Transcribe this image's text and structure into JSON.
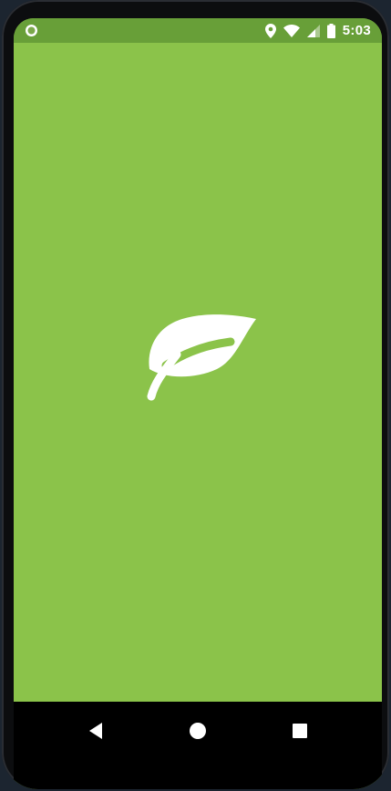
{
  "status_bar": {
    "time": "5:03",
    "icons": [
      "notification-ring-icon",
      "location-pin-icon",
      "wifi-icon",
      "cell-signal-icon",
      "battery-icon"
    ]
  },
  "splash": {
    "logo_icon": "leaf-icon",
    "background_color": "#8bc34a",
    "status_bar_color": "#689f38"
  },
  "nav_bar": {
    "buttons": [
      "back-icon",
      "home-icon",
      "recents-icon"
    ]
  }
}
